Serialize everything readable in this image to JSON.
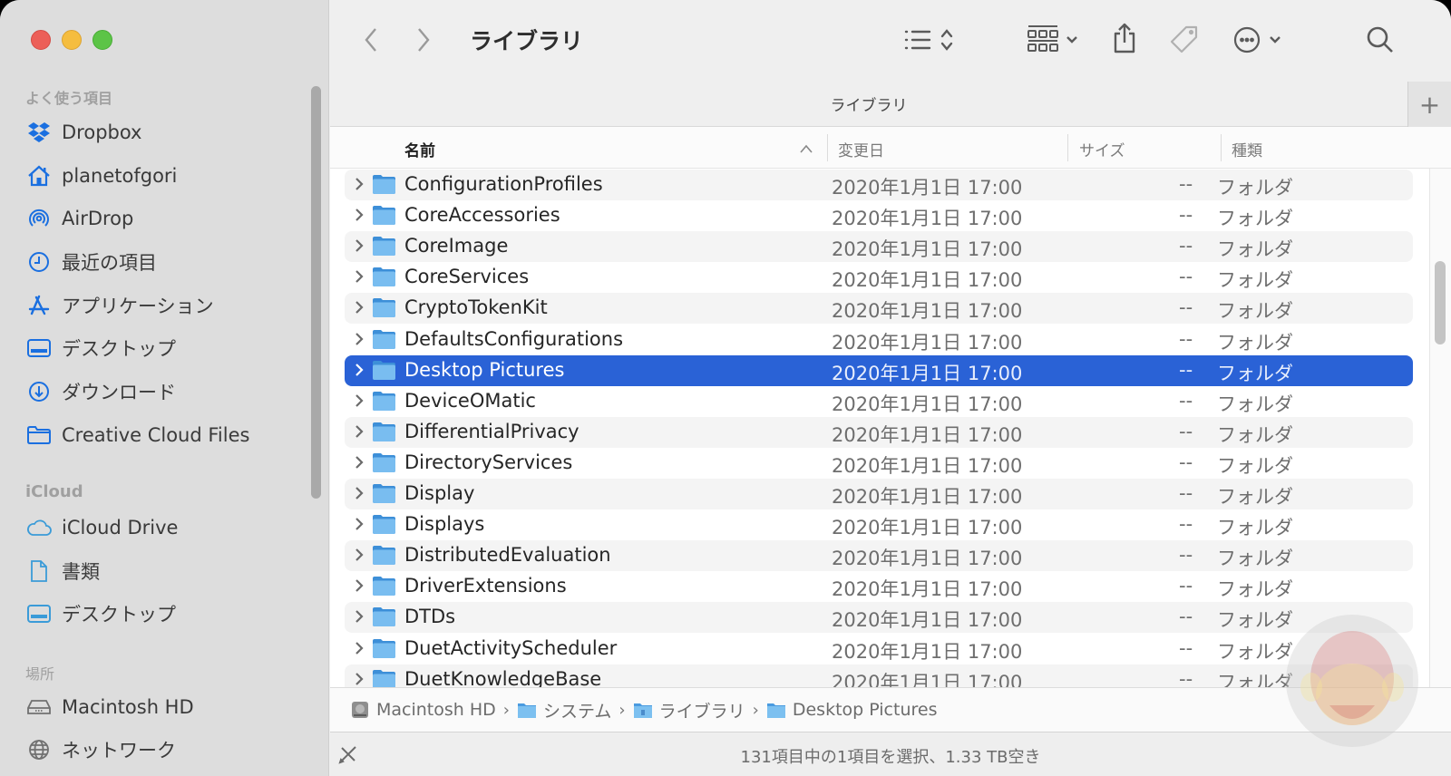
{
  "window": {
    "title": "ライブラリ",
    "tab_title": "ライブラリ",
    "traffic_lights": [
      "close",
      "minimize",
      "maximize"
    ]
  },
  "sidebar": {
    "sections": [
      {
        "label": "よく使う項目",
        "items": [
          {
            "label": "Dropbox",
            "icon": "dropbox-icon"
          },
          {
            "label": "planetofgori",
            "icon": "home-icon"
          },
          {
            "label": "AirDrop",
            "icon": "airdrop-icon"
          },
          {
            "label": "最近の項目",
            "icon": "clock-icon"
          },
          {
            "label": "アプリケーション",
            "icon": "applications-icon"
          },
          {
            "label": "デスクトップ",
            "icon": "desktop-icon"
          },
          {
            "label": "ダウンロード",
            "icon": "download-icon"
          },
          {
            "label": "Creative Cloud Files",
            "icon": "folder-icon"
          }
        ]
      },
      {
        "label": "iCloud",
        "items": [
          {
            "label": "iCloud Drive",
            "icon": "cloud-icon"
          },
          {
            "label": "書類",
            "icon": "document-icon"
          },
          {
            "label": "デスクトップ",
            "icon": "desktop-icon"
          }
        ]
      },
      {
        "label": "場所",
        "items": [
          {
            "label": "Macintosh HD",
            "icon": "disk-icon"
          },
          {
            "label": "ネットワーク",
            "icon": "network-icon"
          }
        ]
      }
    ]
  },
  "toolbar": {
    "back": "back-icon",
    "forward": "forward-icon",
    "view_mode": "list-view-icon",
    "group": "group-icon",
    "share": "share-icon",
    "tag": "tag-icon",
    "action": "more-icon",
    "search": "search-icon",
    "tab_add": "+"
  },
  "columns": {
    "name": "名前",
    "modified": "変更日",
    "size": "サイズ",
    "kind": "種類",
    "sort_indicator": "^"
  },
  "files": [
    {
      "name": "ConfigurationProfiles",
      "modified": "2020年1月1日 17:00",
      "size": "--",
      "kind": "フォルダ"
    },
    {
      "name": "CoreAccessories",
      "modified": "2020年1月1日 17:00",
      "size": "--",
      "kind": "フォルダ"
    },
    {
      "name": "CoreImage",
      "modified": "2020年1月1日 17:00",
      "size": "--",
      "kind": "フォルダ"
    },
    {
      "name": "CoreServices",
      "modified": "2020年1月1日 17:00",
      "size": "--",
      "kind": "フォルダ"
    },
    {
      "name": "CryptoTokenKit",
      "modified": "2020年1月1日 17:00",
      "size": "--",
      "kind": "フォルダ"
    },
    {
      "name": "DefaultsConfigurations",
      "modified": "2020年1月1日 17:00",
      "size": "--",
      "kind": "フォルダ"
    },
    {
      "name": "Desktop Pictures",
      "modified": "2020年1月1日 17:00",
      "size": "--",
      "kind": "フォルダ",
      "selected": true
    },
    {
      "name": "DeviceOMatic",
      "modified": "2020年1月1日 17:00",
      "size": "--",
      "kind": "フォルダ"
    },
    {
      "name": "DifferentialPrivacy",
      "modified": "2020年1月1日 17:00",
      "size": "--",
      "kind": "フォルダ"
    },
    {
      "name": "DirectoryServices",
      "modified": "2020年1月1日 17:00",
      "size": "--",
      "kind": "フォルダ"
    },
    {
      "name": "Display",
      "modified": "2020年1月1日 17:00",
      "size": "--",
      "kind": "フォルダ"
    },
    {
      "name": "Displays",
      "modified": "2020年1月1日 17:00",
      "size": "--",
      "kind": "フォルダ"
    },
    {
      "name": "DistributedEvaluation",
      "modified": "2020年1月1日 17:00",
      "size": "--",
      "kind": "フォルダ"
    },
    {
      "name": "DriverExtensions",
      "modified": "2020年1月1日 17:00",
      "size": "--",
      "kind": "フォルダ"
    },
    {
      "name": "DTDs",
      "modified": "2020年1月1日 17:00",
      "size": "--",
      "kind": "フォルダ"
    },
    {
      "name": "DuetActivityScheduler",
      "modified": "2020年1月1日 17:00",
      "size": "--",
      "kind": "フォルダ"
    },
    {
      "name": "DuetKnowledgeBase",
      "modified": "2020年1月1日 17:00",
      "size": "--",
      "kind": "フォルダ"
    }
  ],
  "pathbar": [
    {
      "label": "Macintosh HD",
      "icon": "disk-icon"
    },
    {
      "label": "システム",
      "icon": "system-folder-icon"
    },
    {
      "label": "ライブラリ",
      "icon": "library-folder-icon"
    },
    {
      "label": "Desktop Pictures",
      "icon": "folder-icon"
    }
  ],
  "pathbar_separator": "›",
  "status": {
    "text": "131項目中の1項目を選択、1.33 TB空き",
    "icon": "no-write-icon"
  },
  "colors": {
    "accent": "#2a62d6",
    "sidebar_icon": "#1a6fe0",
    "folder": "#6fb6ec"
  }
}
